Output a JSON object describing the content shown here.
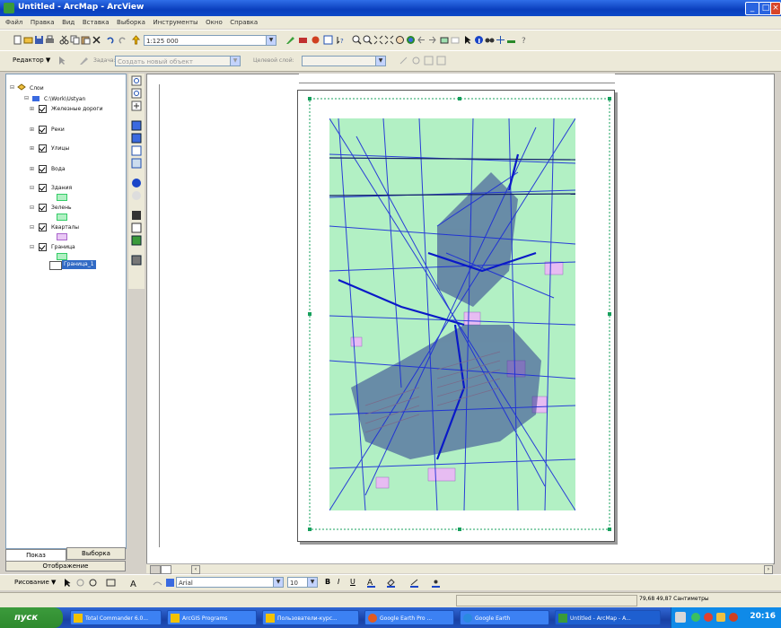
{
  "window": {
    "title": "Untitled - ArcMap - ArcView"
  },
  "menu": {
    "items": [
      "Файл",
      "Правка",
      "Вид",
      "Вставка",
      "Выборка",
      "Инструменты",
      "Окно",
      "Справка"
    ]
  },
  "standard_toolbar": {
    "scale_value": "1:125 000"
  },
  "editor_toolbar": {
    "editor_label": "Редактор ▼",
    "task_label": "Задача:",
    "task_value": "Создать новый объект",
    "target_label": "Целевой слой:",
    "target_value": ""
  },
  "toc": {
    "root_label": "Слои",
    "group_label": "С:\\Work\\Ustyan",
    "layers": [
      {
        "label": "Железные дороги"
      },
      {
        "label": "Реки"
      },
      {
        "label": "Улицы"
      },
      {
        "label": "Вода"
      },
      {
        "label": "Здания"
      },
      {
        "label": "Зелень"
      },
      {
        "label": "Кварталы"
      },
      {
        "label": "Граница"
      }
    ],
    "selected_label": "Граница_1",
    "tabs": [
      "Показ",
      "Выборка"
    ],
    "bottom_tab": "Отображение"
  },
  "draw_toolbar": {
    "drawing_label": "Рисование ▼",
    "font_value": "Arial",
    "size_value": "10"
  },
  "status": {
    "coords": "79,68  49,87 Сантиметры"
  },
  "taskbar": {
    "start_label": "пуск",
    "tasks": [
      "Total Commander 6.0...",
      "ArcGIS Programs",
      "Пользователи-курс...",
      "Google Earth Pro ...",
      "Google Earth",
      "Untitled - ArcMap - A..."
    ],
    "clock": "20:16"
  },
  "colors": {
    "title_blue": "#0a3fbd",
    "face": "#ece9d8",
    "map_green": "#b2f0c4",
    "map_blue": "#1a2bd8",
    "map_pink": "#e8b8f0",
    "task_blue": "#3c81f3"
  }
}
